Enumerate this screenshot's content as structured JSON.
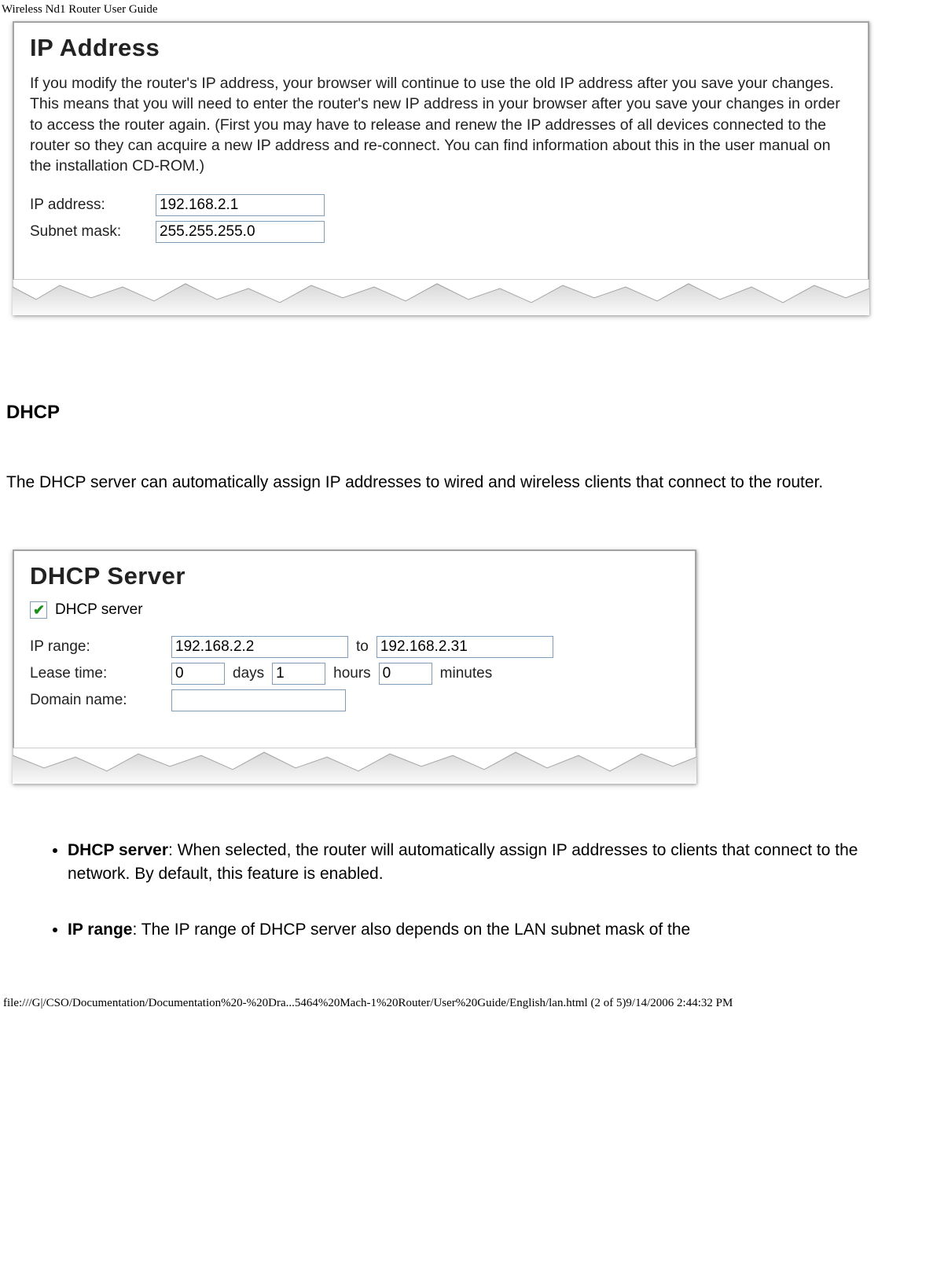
{
  "header": {
    "title": "Wireless Nd1 Router User Guide"
  },
  "ip_panel": {
    "title": "IP Address",
    "body": "If you modify the router's IP address, your browser will continue to use the old IP address after you save your changes. This means that you will need to enter the router's new IP address in your browser after you save your changes in order to access the router again. (First you may have to release and renew the IP addresses of all devices connected to the router so they can acquire a new IP address and re-connect. You can find information about this in the user manual on the installation CD-ROM.)",
    "ip_label": "IP address:",
    "ip_value": "192.168.2.1",
    "mask_label": "Subnet mask:",
    "mask_value": "255.255.255.0"
  },
  "dhcp_section": {
    "heading": "DHCP",
    "intro": "The DHCP server can automatically assign IP addresses to wired and wireless clients that connect to the router."
  },
  "dhcp_panel": {
    "title": "DHCP Server",
    "checkbox_label": "DHCP server",
    "checkbox_checked": true,
    "range_label": "IP range:",
    "range_from": "192.168.2.2",
    "range_to_label": "to",
    "range_to": "192.168.2.31",
    "lease_label": "Lease time:",
    "lease_days": "0",
    "lease_days_label": "days",
    "lease_hours": "1",
    "lease_hours_label": "hours",
    "lease_minutes": "0",
    "lease_minutes_label": "minutes",
    "domain_label": "Domain name:",
    "domain_value": ""
  },
  "bullets": {
    "b1_term": "DHCP server",
    "b1_text": ": When selected, the router will automatically assign IP addresses to clients that connect to the network. By default, this feature is enabled.",
    "b2_term": "IP range",
    "b2_text": ": The IP range of DHCP server also depends on the LAN subnet mask of the"
  },
  "footer": {
    "text": "file:///G|/CSO/Documentation/Documentation%20-%20Dra...5464%20Mach-1%20Router/User%20Guide/English/lan.html (2 of 5)9/14/2006 2:44:32 PM"
  }
}
